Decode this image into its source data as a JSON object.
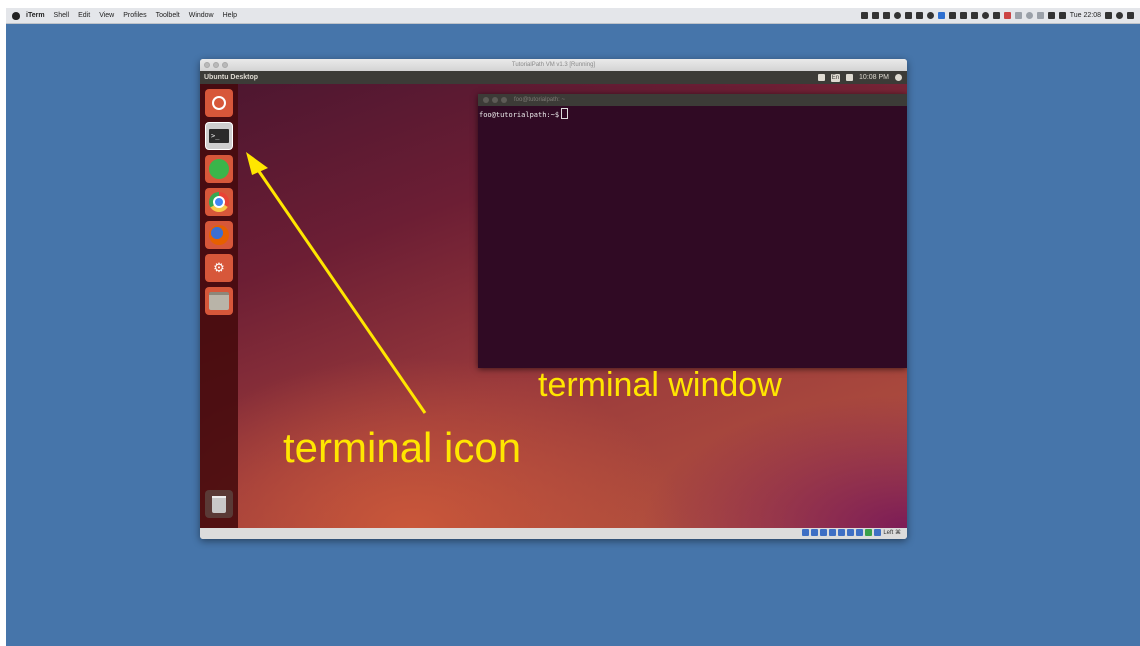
{
  "mac_menubar": {
    "app_name": "iTerm",
    "menus": [
      "Shell",
      "Edit",
      "View",
      "Profiles",
      "Toolbelt",
      "Window",
      "Help"
    ],
    "clock": "Tue 22:08"
  },
  "vm_window": {
    "title": "TutorialPath VM v1.3 [Running]",
    "host_key_label": "Left ⌘"
  },
  "ubuntu": {
    "top_bar_title": "Ubuntu Desktop",
    "keyboard_layout": "En",
    "clock": "10:08 PM",
    "launcher_items": [
      {
        "name": "dash-home-icon",
        "color": "#d7573a"
      },
      {
        "name": "terminal-icon",
        "color": "#3a3a3a"
      },
      {
        "name": "software-center-icon",
        "color": "#3ab54a"
      },
      {
        "name": "chrome-icon",
        "color": "#e94235"
      },
      {
        "name": "firefox-icon",
        "color": "#e66000"
      },
      {
        "name": "system-settings-icon",
        "color": "#8a8a8a"
      },
      {
        "name": "files-icon",
        "color": "#b9b4a8"
      }
    ]
  },
  "terminal": {
    "title": "foo@tutorialpath: ~",
    "prompt": "foo@tutorialpath:~$"
  },
  "annotations": {
    "terminal_window_label": "terminal window",
    "terminal_icon_label": "terminal icon",
    "color": "#ffe600"
  }
}
